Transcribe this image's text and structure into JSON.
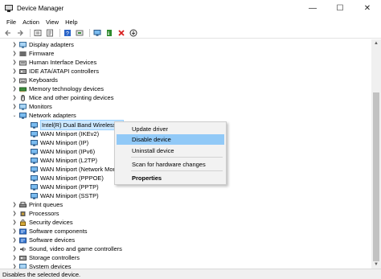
{
  "window": {
    "title": "Device Manager",
    "minimize": "—",
    "maximize": "☐",
    "close": "✕"
  },
  "menu": [
    "File",
    "Action",
    "View",
    "Help"
  ],
  "toolbar": [
    "back-icon",
    "forward-icon",
    "tree-view-icon",
    "properties-icon",
    "help-icon",
    "update-driver-icon",
    "scan-hardware-icon",
    "enable-device-icon",
    "uninstall-icon",
    "download-icon"
  ],
  "tree": {
    "top": [
      "Display adapters",
      "Firmware",
      "Human Interface Devices",
      "IDE ATA/ATAPI controllers",
      "Keyboards",
      "Memory technology devices",
      "Mice and other pointing devices",
      "Monitors"
    ],
    "network": {
      "label": "Network adapters",
      "children": [
        "Intel(R) Dual Band Wireless-A",
        "WAN Miniport (IKEv2)",
        "WAN Miniport (IP)",
        "WAN Miniport (IPv6)",
        "WAN Miniport (L2TP)",
        "WAN Miniport (Network Mon",
        "WAN Miniport (PPPOE)",
        "WAN Miniport (PPTP)",
        "WAN Miniport (SSTP)"
      ]
    },
    "bottom": [
      "Print queues",
      "Processors",
      "Security devices",
      "Software components",
      "Software devices",
      "Sound, video and game controllers",
      "Storage controllers",
      "System devices"
    ]
  },
  "context_menu": {
    "items": [
      "Update driver",
      "Disable device",
      "Uninstall device",
      "Scan for hardware changes",
      "Properties"
    ],
    "highlighted": "Disable device"
  },
  "status": "Disables the selected device."
}
